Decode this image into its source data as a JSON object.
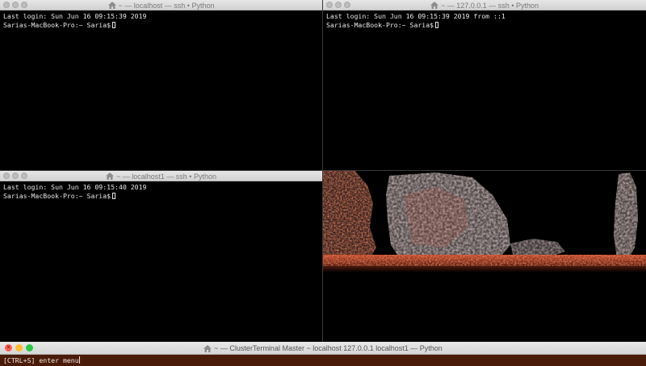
{
  "windows": {
    "top_left": {
      "title": "~ — localhost — ssh • Python",
      "lines": [
        "Last login: Sun Jun 16 09:15:39 2019",
        "Sarias-MacBook-Pro:~ Saria$"
      ]
    },
    "top_right": {
      "title": "~ — 127.0.0.1 — ssh • Python",
      "lines": [
        "Last login: Sun Jun 16 09:15:39 2019 from ::1",
        "Sarias-MacBook-Pro:~ Saria$"
      ]
    },
    "bottom_left": {
      "title": "~ — localhost1 — ssh • Python",
      "lines": [
        "Last login: Sun Jun 16 09:15:40 2019",
        "Sarias-MacBook-Pro:~ Saria$"
      ]
    }
  },
  "master": {
    "title": "~ — ClusterTerminal Master ~ localhost 127.0.0.1 localhost1 — Python",
    "input": "[CTRL+S] enter menu"
  },
  "colors": {
    "master_bg": "#4b1b0a",
    "close": "#ff5f56",
    "minimize": "#ffbd2e",
    "zoom": "#27c93f"
  },
  "icons": [
    "close-icon",
    "home-icon",
    "text-cursor-icon"
  ]
}
